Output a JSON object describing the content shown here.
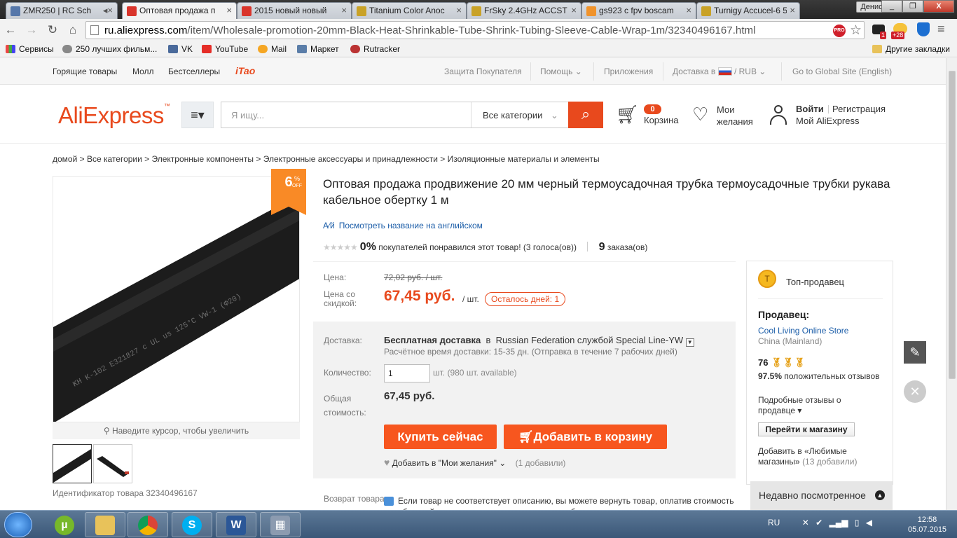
{
  "browser": {
    "tabs": [
      {
        "label": "ZMR250 | RC Sch",
        "color": "#5577aa"
      },
      {
        "label": "Оптовая продажа п",
        "color": "#d9342b"
      },
      {
        "label": "2015 новый новый",
        "color": "#d9342b"
      },
      {
        "label": "Titanium Color Anoc",
        "color": "#c9a227"
      },
      {
        "label": "FrSky 2.4GHz ACCST",
        "color": "#c9a227"
      },
      {
        "label": "gs923 с fpv boscam",
        "color": "#f0932b"
      },
      {
        "label": "Turnigy Accucel-6 50",
        "color": "#c9a227"
      }
    ],
    "user": "Денис",
    "url_host": "ru.aliexpress.com",
    "url_path": "/item/Wholesale-promotion-20mm-Black-Heat-Shrinkable-Tube-Shrink-Tubing-Sleeve-Cable-Wrap-1m/32340496167.html",
    "ext_badge_1": "1",
    "ext_badge_2": "+28",
    "bookmarks": [
      "Сервисы",
      "250 лучших фильм...",
      "VK",
      "YouTube",
      "Mail",
      "Маркет",
      "Rutracker"
    ],
    "other_bookmarks": "Другие закладки"
  },
  "topnav": {
    "left": [
      "Горящие товары",
      "Молл",
      "Бестселлеры",
      "iTao"
    ],
    "protection": "Защита Покупателя",
    "help": "Помощь",
    "apps": "Приложения",
    "delivery": "Доставка в",
    "currency": "/ RUB",
    "global": "Go to Global Site (English)"
  },
  "header": {
    "logo": "AliExpress",
    "search_placeholder": "Я ищу...",
    "category": "Все категории",
    "cart_count": "0",
    "cart": "Корзина",
    "wish_1": "Мои",
    "wish_2": "желания",
    "login": "Войти",
    "register": "Регистрация",
    "my_ali": "Мой AliExpress"
  },
  "breadcrumb": "домой > Все категории > Электронные компоненты > Электронные аксессуары и принадлежности > Изоляционные материалы и элементы",
  "gallery": {
    "discount": "6",
    "discount_pct": "%",
    "discount_off": "OFF",
    "zoom_hint": "Наведите курсор, чтобы увеличить",
    "tube_print": "KH  K-102  E321827  c UL us  125°C  VW-1  (Φ20)",
    "product_id": "Идентификатор товара 32340496167"
  },
  "product": {
    "title": "Оптовая продажа продвижение 20 мм черный термоусадочная трубка термоусадочные трубки рукава кабельное обертку 1 м",
    "translate": "Посмотреть название на английском",
    "rating_pct": "0%",
    "rating_text": "покупателей понравился этот товар! (3 голоса(ов))",
    "orders": "9",
    "orders_label": "заказа(ов)",
    "price_label": "Цена:",
    "old_price": "72,02 руб. / шт.",
    "discount_label": "Цена со скидкой:",
    "new_price": "67,45 руб.",
    "per_unit": "/ шт.",
    "timer": "Осталось дней: 1",
    "shipping_label": "Доставка:",
    "shipping_free": "Бесплатная доставка",
    "shipping_in": "в",
    "shipping_dest": "Russian Federation службой Special Line-YW",
    "shipping_time": "Расчётное время доставки: 15-35 дн. (Отправка в течение 7 рабочих дней)",
    "qty_label": "Количество:",
    "qty_value": "1",
    "qty_avail": "шт. (980 шт. available)",
    "total_label": "Общая стоимость:",
    "total": "67,45 руб.",
    "buy_now": "Купить сейчас",
    "add_cart": "Добавить в корзину",
    "add_wish": "Добавить в \"Мои желания\"",
    "wish_count": "(1 добавили)",
    "return_label": "Возврат товара:",
    "return_text": "Если товар не соответствует описанию, вы можете вернуть товар, оплатив стоимость обратной пересылки, или оставить товар себе и договориться о компенсации с"
  },
  "seller": {
    "top": "Топ-продавец",
    "title": "Продавец:",
    "name": "Cool Living Online Store",
    "country": "China (Mainland)",
    "score": "76",
    "positive": "97.5%",
    "positive_text": "положительных отзывов",
    "details": "Подробные отзывы о продавце",
    "go_store": "Перейти к магазину",
    "add_fav": "Добавить в «Любимые магазины»",
    "fav_count": "(13 добавили)"
  },
  "recent": "Недавно посмотренное",
  "taskbar": {
    "lang": "RU",
    "time": "12:58",
    "date": "05.07.2015"
  }
}
